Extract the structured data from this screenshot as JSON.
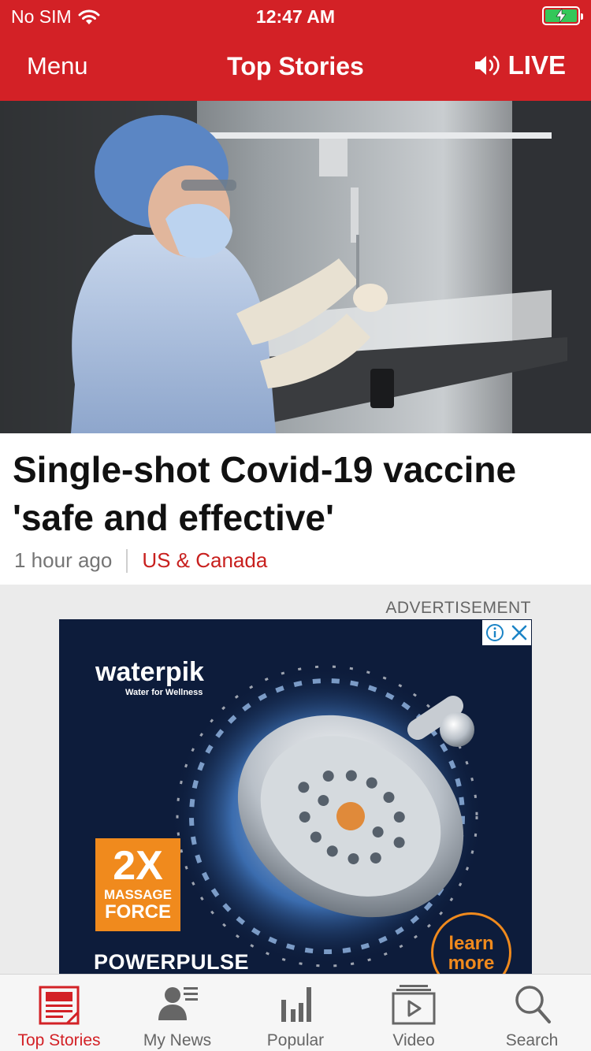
{
  "status_bar": {
    "carrier": "No SIM",
    "time": "12:47 AM",
    "battery_state": "charging"
  },
  "header": {
    "menu_label": "Menu",
    "title": "Top Stories",
    "live_label": "LIVE"
  },
  "story": {
    "headline": "Single-shot Covid-19 vaccine 'safe and effective'",
    "age": "1 hour ago",
    "section": "US & Canada"
  },
  "advertisement": {
    "label": "ADVERTISEMENT",
    "brand": "waterpik",
    "tagline": "Water for Wellness",
    "badge_big": "2X",
    "badge_line1": "MASSAGE",
    "badge_line2": "FORCE",
    "product": "POWERPULSE",
    "cta_line1": "learn",
    "cta_line2": "more"
  },
  "tabs": [
    {
      "label": "Top Stories",
      "icon": "top-stories-icon",
      "active": true
    },
    {
      "label": "My News",
      "icon": "my-news-icon",
      "active": false
    },
    {
      "label": "Popular",
      "icon": "popular-icon",
      "active": false
    },
    {
      "label": "Video",
      "icon": "video-icon",
      "active": false
    },
    {
      "label": "Search",
      "icon": "search-icon",
      "active": false
    }
  ],
  "colors": {
    "brand_red": "#d32126",
    "section_red": "#c8201e",
    "ad_orange": "#f08a1d",
    "battery_green": "#34c759"
  }
}
